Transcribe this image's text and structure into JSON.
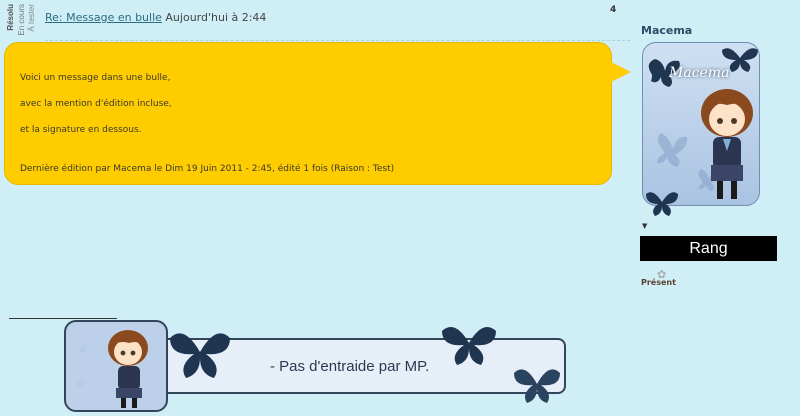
{
  "status_tags": [
    "Résolu",
    "En cours",
    "À tester"
  ],
  "post": {
    "title_link": "Re: Message en bulle",
    "time": "Aujourd'hui à 2:44",
    "number": "4"
  },
  "bubble": {
    "lines": [
      "Voici un message dans une bulle,",
      "avec la mention d'édition incluse,",
      "et la signature en dessous.",
      "Dernière édition par Macema le Dim 19 Juin 2011 - 2:45, édité 1 fois (Raison : Test)"
    ],
    "color": "#ffcc00"
  },
  "profile": {
    "username": "Macema",
    "avatar_title": "Macema",
    "rank": "Rang",
    "status": "Présent"
  },
  "signature": {
    "text": "- Pas d'entraide par MP."
  },
  "colors": {
    "background": "#cfeef5",
    "link": "#2a6d84",
    "bubble": "#ffcc00",
    "rank_bar": "#000000"
  }
}
